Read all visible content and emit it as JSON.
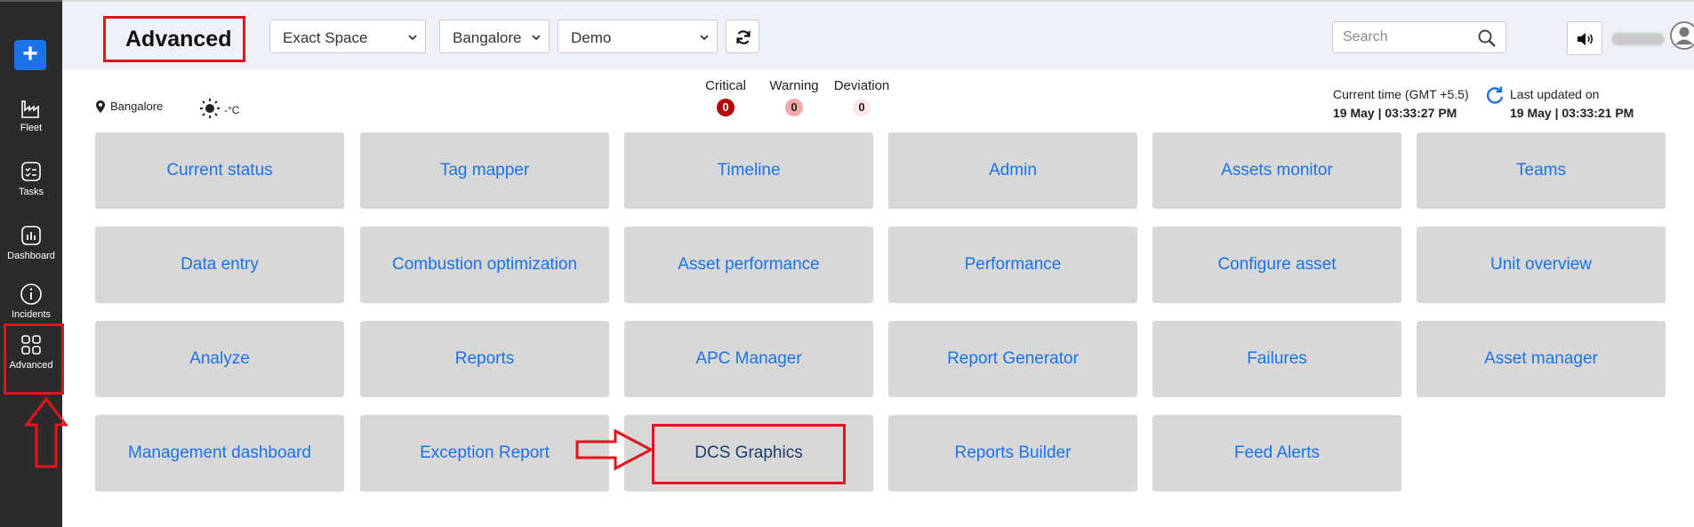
{
  "sidebar": {
    "add_label": "+",
    "items": [
      {
        "label": "Fleet",
        "icon": "factory-icon"
      },
      {
        "label": "Tasks",
        "icon": "checklist-icon"
      },
      {
        "label": "Dashboard",
        "icon": "bar-chart-icon"
      },
      {
        "label": "Incidents",
        "icon": "info-icon"
      },
      {
        "label": "Advanced",
        "icon": "grid-icon"
      }
    ]
  },
  "header": {
    "title": "Advanced",
    "selects": {
      "space": "Exact Space",
      "location": "Bangalore",
      "site": "Demo"
    },
    "search_placeholder": "Search"
  },
  "info": {
    "location": "Bangalore",
    "temperature": "-°C",
    "alerts": [
      {
        "label": "Critical",
        "count": "0"
      },
      {
        "label": "Warning",
        "count": "0"
      },
      {
        "label": "Deviation",
        "count": "0"
      }
    ],
    "current_time_label": "Current time (GMT +5.5)",
    "current_time_value": "19 May | 03:33:27 PM",
    "last_updated_label": "Last updated on",
    "last_updated_value": "19 May | 03:33:21 PM"
  },
  "tiles": [
    "Current status",
    "Tag mapper",
    "Timeline",
    "Admin",
    "Assets monitor",
    "Teams",
    "Data entry",
    "Combustion optimization",
    "Asset performance",
    "Performance",
    "Configure asset",
    "Unit overview",
    "Analyze",
    "Reports",
    "APC Manager",
    "Report Generator",
    "Failures",
    "Asset manager",
    "Management dashboard",
    "Exception Report",
    "DCS Graphics",
    "Reports Builder",
    "Feed Alerts"
  ],
  "colors": {
    "accent": "#1a73e8",
    "annotation": "#e3151c",
    "sidebar": "#2b2b2b",
    "tile": "#d8d8d8"
  }
}
